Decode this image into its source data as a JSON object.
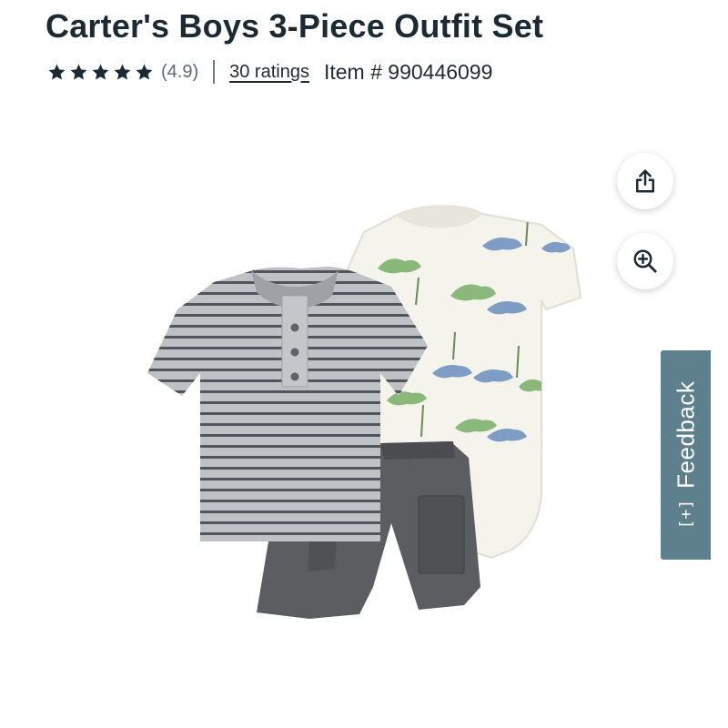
{
  "product": {
    "title": "Carter's Boys 3-Piece Outfit Set",
    "rating_value": "(4.9)",
    "star_count": 5,
    "rating_fraction": 0.98,
    "ratings_link": "30 ratings",
    "item_label": "Item # 990446099"
  },
  "actions": {
    "share_icon": "share-icon",
    "zoom_icon": "zoom-in-icon"
  },
  "feedback": {
    "label": "Feedback",
    "icon": "[+]"
  },
  "colors": {
    "feedback_bg": "#5e808d",
    "star": "#1c2a33",
    "title": "#1c2a33"
  }
}
